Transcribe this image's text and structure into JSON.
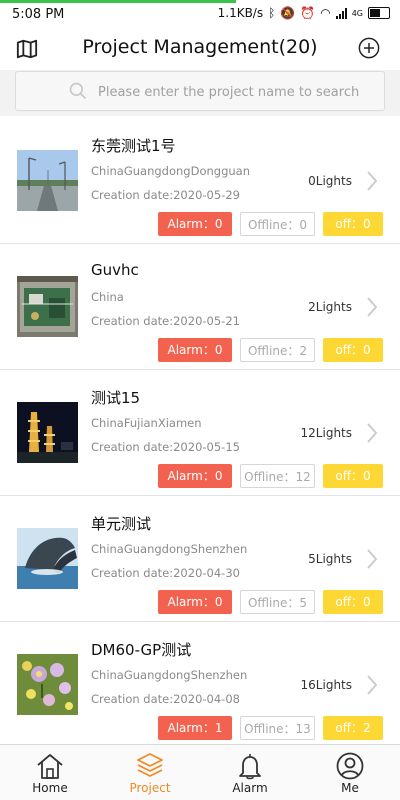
{
  "status_bar": {
    "time": "5:08 PM",
    "net_speed": "1.1KB/s",
    "network": "4G",
    "icons": [
      "bluetooth-icon",
      "mute-icon",
      "alarm-clock-icon",
      "wifi-icon",
      "signal-icon",
      "battery-icon"
    ],
    "load_progress": 0.59
  },
  "header": {
    "title": "Project Management(20)",
    "left_icon": "map-icon",
    "right_icon": "add-circle-icon"
  },
  "search": {
    "placeholder": "Please enter the project name to search",
    "value": ""
  },
  "projects": [
    {
      "name": "东莞测试1号",
      "location": "ChinaGuangdongDongguan",
      "date": "Creation date:2020-05-29",
      "lights": "0Lights",
      "alarm": "Alarm：0",
      "offline": "Offline：0",
      "off": "off：0",
      "thumbnail": "street-photo"
    },
    {
      "name": "Guvhc",
      "location": "China",
      "date": "Creation date:2020-05-21",
      "lights": "2Lights",
      "alarm": "Alarm：0",
      "offline": "Offline：2",
      "off": "off：0",
      "thumbnail": "circuit-board-photo"
    },
    {
      "name": "测试15",
      "location": "ChinaFujianXiamen",
      "date": "Creation date:2020-05-15",
      "lights": "12Lights",
      "alarm": "Alarm：0",
      "offline": "Offline：12",
      "off": "off：0",
      "thumbnail": "pagoda-night-photo"
    },
    {
      "name": "单元测试",
      "location": "ChinaGuangdongShenzhen",
      "date": "Creation date:2020-04-30",
      "lights": "5Lights",
      "alarm": "Alarm：0",
      "offline": "Offline：5",
      "off": "off：0",
      "thumbnail": "whale-photo"
    },
    {
      "name": "DM60-GP测试",
      "location": "ChinaGuangdongShenzhen",
      "date": "Creation date:2020-04-08",
      "lights": "16Lights",
      "alarm": "Alarm：1",
      "offline": "Offline：13",
      "off": "off：2",
      "thumbnail": "flowers-photo"
    }
  ],
  "nav": {
    "items": [
      {
        "label": "Home",
        "icon": "home-icon",
        "active": false
      },
      {
        "label": "Project",
        "icon": "layers-icon",
        "active": true
      },
      {
        "label": "Alarm",
        "icon": "bell-icon",
        "active": false
      },
      {
        "label": "Me",
        "icon": "user-icon",
        "active": false
      }
    ]
  },
  "colors": {
    "alarm": "#f2624f",
    "off": "#fdd835",
    "active_nav": "#f08a24",
    "progress": "#3ac34a"
  }
}
